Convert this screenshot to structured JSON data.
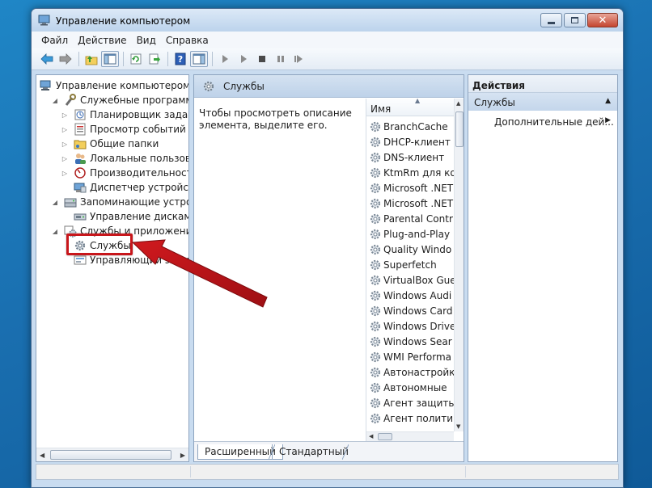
{
  "window": {
    "title": "Управление компьютером"
  },
  "menu": [
    {
      "label": "Файл"
    },
    {
      "label": "Действие"
    },
    {
      "label": "Вид"
    },
    {
      "label": "Справка"
    }
  ],
  "toolbar": {
    "buttons": [
      "back-arrow-icon",
      "forward-arrow-icon",
      "up-folder-icon",
      "show-hide-tree-icon",
      "refresh-icon",
      "export-list-icon",
      "help-icon",
      "show-hide-action-pane-icon",
      "start-service-icon",
      "start-service-alt-icon",
      "stop-service-icon",
      "pause-service-icon",
      "restart-service-icon"
    ]
  },
  "tree": {
    "items": [
      {
        "label": "Управление компьютером (л",
        "level": 0,
        "expander": "",
        "icon": "computer-management-icon"
      },
      {
        "label": "Служебные программы",
        "level": 1,
        "expander": "expanded",
        "icon": "tools-icon"
      },
      {
        "label": "Планировщик заданий",
        "level": 2,
        "expander": "collapsed",
        "icon": "task-scheduler-icon"
      },
      {
        "label": "Просмотр событий",
        "level": 2,
        "expander": "collapsed",
        "icon": "event-viewer-icon"
      },
      {
        "label": "Общие папки",
        "level": 2,
        "expander": "collapsed",
        "icon": "shared-folders-icon"
      },
      {
        "label": "Локальные пользовате",
        "level": 2,
        "expander": "collapsed",
        "icon": "local-users-icon"
      },
      {
        "label": "Производительность",
        "level": 2,
        "expander": "collapsed",
        "icon": "performance-icon"
      },
      {
        "label": "Диспетчер устройств",
        "level": 2,
        "expander": "",
        "icon": "device-manager-icon"
      },
      {
        "label": "Запоминающие устройст",
        "level": 1,
        "expander": "expanded",
        "icon": "storage-icon"
      },
      {
        "label": "Управление дисками",
        "level": 2,
        "expander": "",
        "icon": "disk-management-icon"
      },
      {
        "label": "Службы и приложения",
        "level": 1,
        "expander": "expanded",
        "icon": "services-apps-icon"
      },
      {
        "label": "Службы",
        "level": 2,
        "expander": "",
        "icon": "services-gear-icon"
      },
      {
        "label": "Управляющий элемент",
        "level": 2,
        "expander": "",
        "icon": "wmi-control-icon"
      }
    ]
  },
  "center": {
    "header": "Службы",
    "description": "Чтобы просмотреть описание элемента, выделите его.",
    "column_name": "Имя",
    "services": [
      "BranchCache",
      "DHCP-клиент",
      "DNS-клиент",
      "KtmRm для ко",
      "Microsoft .NET",
      "Microsoft .NET",
      "Parental Contr",
      "Plug-and-Play",
      "Quality Windo",
      "Superfetch",
      "VirtualBox Gue",
      "Windows Audi",
      "Windows Card",
      "Windows Drive",
      "Windows Sear",
      "WMI Performa",
      "Автонастройк",
      "Автономные",
      "Агент защиты",
      "Агент полити"
    ],
    "tabs": {
      "extended": "Расширенный",
      "standard": "Стандартный"
    }
  },
  "actions": {
    "title": "Действия",
    "section": "Службы",
    "item": "Дополнительные дей..."
  },
  "colors": {
    "accent_red": "#c8161b",
    "desktop_blue": "#1a6fb0",
    "pane_border": "#8ea4bf"
  }
}
